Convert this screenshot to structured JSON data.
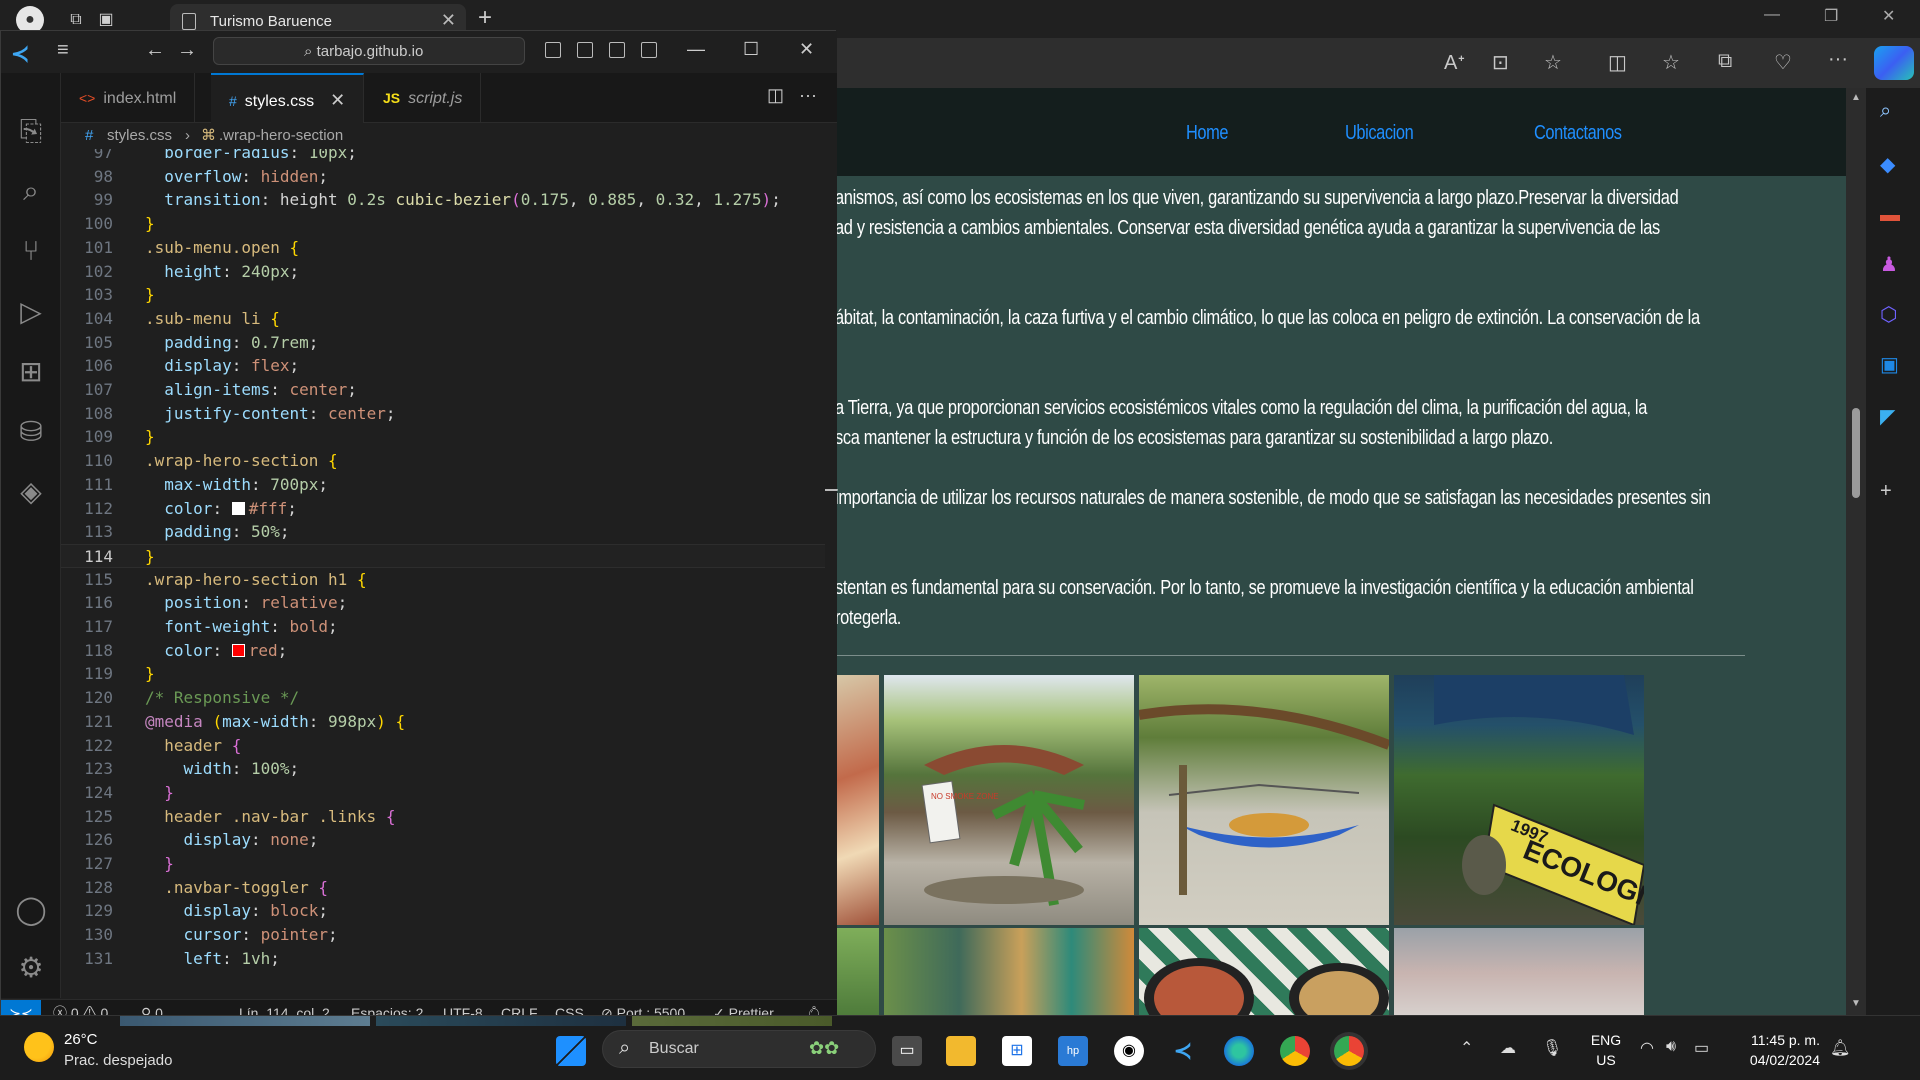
{
  "browser": {
    "tab_title": "Turismo Baruence",
    "nav_links": [
      "Home",
      "Ubicacion",
      "Contactanos"
    ],
    "paragraphs": [
      "anismos, así como los ecosistemas en los que viven, garantizando su supervivencia a largo plazo.Preservar la diversidad",
      "ad y resistencia a cambios ambientales. Conservar esta diversidad genética ayuda a garantizar la supervivencia de las",
      "ábitat, la contaminación, la caza furtiva y el cambio climático, lo que las coloca en peligro de extinción. La conservación de la",
      "a Tierra, ya que proporcionan servicios ecosistémicos vitales como la regulación del clima, la purificación del agua, la",
      "sca mantener la estructura y función de los ecosistemas para garantizar su sostenibilidad a largo plazo.",
      "importancia de utilizar los recursos naturales de manera sostenible, de modo que se satisfagan las necesidades presentes sin",
      "stentan es fundamental para su conservación. Por lo tanto, se promueve la investigación científica y la educación ambiental",
      "rotegerla."
    ],
    "photo_texts": {
      "sign": "NO SMOKE ZONE",
      "banner_year": "1997",
      "banner_word": "ECOLOGICO"
    }
  },
  "vscode": {
    "search_text": "tarbajo.github.io",
    "tabs": [
      {
        "icon": "<>",
        "label": "index.html"
      },
      {
        "icon": "#",
        "label": "styles.css"
      },
      {
        "icon": "JS",
        "label": "script.js"
      }
    ],
    "breadcrumb": {
      "file": "styles.css",
      "symbol": "wrap-hero-section"
    },
    "current_line": 114,
    "status": {
      "errors": "0",
      "warnings": "0",
      "ports": "0",
      "position": "Lín. 114, col. 2",
      "spaces": "Espacios: 2",
      "encoding": "UTF-8",
      "eol": "CRLF",
      "language": "CSS",
      "port": "Port : 5500",
      "formatter": "Prettier"
    }
  },
  "taskbar": {
    "temperature": "26°C",
    "weather": "Prac. despejado",
    "search_label": "Buscar",
    "lang_primary": "ENG",
    "lang_secondary": "US",
    "time": "11:45 p. m.",
    "date": "04/02/2024"
  },
  "colors": {
    "page_bg": "#2f4a46",
    "nav_bg": "#141e1d",
    "link": "#1f8fff",
    "vscode_accent": "#0078d4"
  }
}
